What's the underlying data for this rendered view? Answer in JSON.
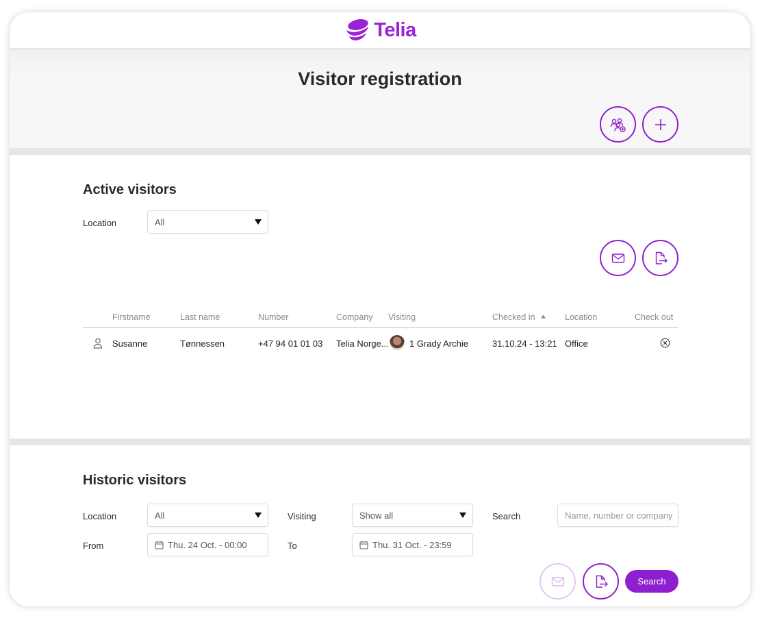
{
  "brand": {
    "name": "Telia",
    "color": "#9b23d6"
  },
  "page": {
    "title": "Visitor registration"
  },
  "header_actions": [
    {
      "icon": "users-add-icon"
    },
    {
      "icon": "plus-icon"
    }
  ],
  "active": {
    "title": "Active visitors",
    "location_label": "Location",
    "location_value": "All",
    "actions": [
      {
        "icon": "mail-icon"
      },
      {
        "icon": "export-icon"
      }
    ],
    "columns": [
      "Firstname",
      "Last name",
      "Number",
      "Company",
      "Visiting",
      "Checked in",
      "Location",
      "Check out"
    ],
    "sort_column": "Checked in",
    "sort_direction": "ascending",
    "rows": [
      {
        "icon": "person-icon",
        "firstname": "Susanne",
        "lastname": "Tønnessen",
        "number": "+47 94 01 01 03",
        "company": "Telia Norge...",
        "visiting": "1 Grady Archie",
        "checked_in": "31.10.24 - 13:21",
        "location": "Office",
        "checkout_icon": "close-circle-icon"
      }
    ]
  },
  "historic": {
    "title": "Historic visitors",
    "location_label": "Location",
    "location_value": "All",
    "visiting_label": "Visiting",
    "visiting_value": "Show all",
    "search_label": "Search",
    "search_placeholder": "Name, number or company",
    "from_label": "From",
    "from_value": "Thu. 24 Oct. - 00:00",
    "to_label": "To",
    "to_value": "Thu. 31 Oct. - 23:59",
    "search_button": "Search"
  }
}
